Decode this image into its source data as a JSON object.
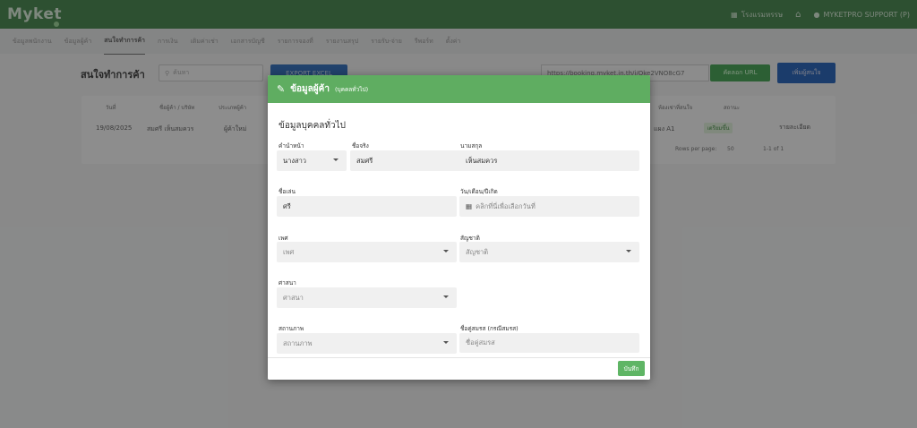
{
  "app": {
    "logo": "Myket"
  },
  "topbar": {
    "store_label": "โรงแรมหรรษ",
    "home_icon": "home-icon",
    "user_label": "MYKETPRO SUPPORT (P)"
  },
  "nav": {
    "tabs": [
      "ข้อมูลพนักงาน",
      "ข้อมูลผู้ค้า",
      "สนใจทำการค้า",
      "การเงิน",
      "เติมค่าเช่า",
      "เอกสารบัญชี",
      "รายการจองที่",
      "รายงานสรุป",
      "รายรับ-จ่าย",
      "รีพอร์ท",
      "ตั้งค่า"
    ],
    "active_index": 2
  },
  "page": {
    "title": "สนใจทำการค้า",
    "search_placeholder": "ค้นหา",
    "export_label": "EXPORT EXCEL",
    "booking_url": "https://booking.myket.in.th/i/Qke2VNO8cG7",
    "copy_url_label": "คัดลอก URL",
    "add_button_label": "เพิ่มผู้สนใจ"
  },
  "table": {
    "headers": [
      "วันที่",
      "ชื่อผู้ค้า / บริษัท",
      "ประเภทผู้ค้า",
      "",
      "ห้องเช่าที่สนใจ",
      "",
      "สถานะ"
    ],
    "row": {
      "date": "19/08/2025",
      "name": "สมศรี เห็นสมควร",
      "type": "ผู้ค้าใหม่",
      "room": "แผง A1",
      "status": "เตรียมขึ้น",
      "action": "รายละเอียด"
    },
    "rows_per_page_label": "Rows per page:",
    "rows_per_page": "50",
    "range": "1-1 of 1"
  },
  "modal": {
    "title": "ข้อมูลผู้ค้า",
    "subtitle": "(บุคคลทั่วไป)",
    "section": "ข้อมูลบุคคลทั่วไป",
    "fields": {
      "prefix": {
        "label": "คำนำหน้า",
        "value": "นางสาว"
      },
      "firstname": {
        "label": "ชื่อจริง",
        "value": "สมศรี"
      },
      "lastname": {
        "label": "นามสกุล",
        "value": "เห็นสมควร"
      },
      "nickname": {
        "label": "ชื่อเล่น",
        "value": "ศรี"
      },
      "birthdate": {
        "label": "วัน/เดือน/ปีเกิด",
        "placeholder": "คลิกที่นี่เพื่อเลือกวันที่"
      },
      "gender": {
        "label": "เพศ",
        "placeholder": "เพศ"
      },
      "nationality": {
        "label": "สัญชาติ",
        "placeholder": "สัญชาติ"
      },
      "religion": {
        "label": "ศาสนา",
        "placeholder": "ศาสนา"
      },
      "marital": {
        "label": "สถานภาพ",
        "placeholder": "สถานภาพ"
      },
      "spouse": {
        "label": "ชื่อคู่สมรส (กรณีสมรส)",
        "placeholder": "ชื่อคู่สมรส"
      }
    },
    "save_label": "บันทึก"
  }
}
